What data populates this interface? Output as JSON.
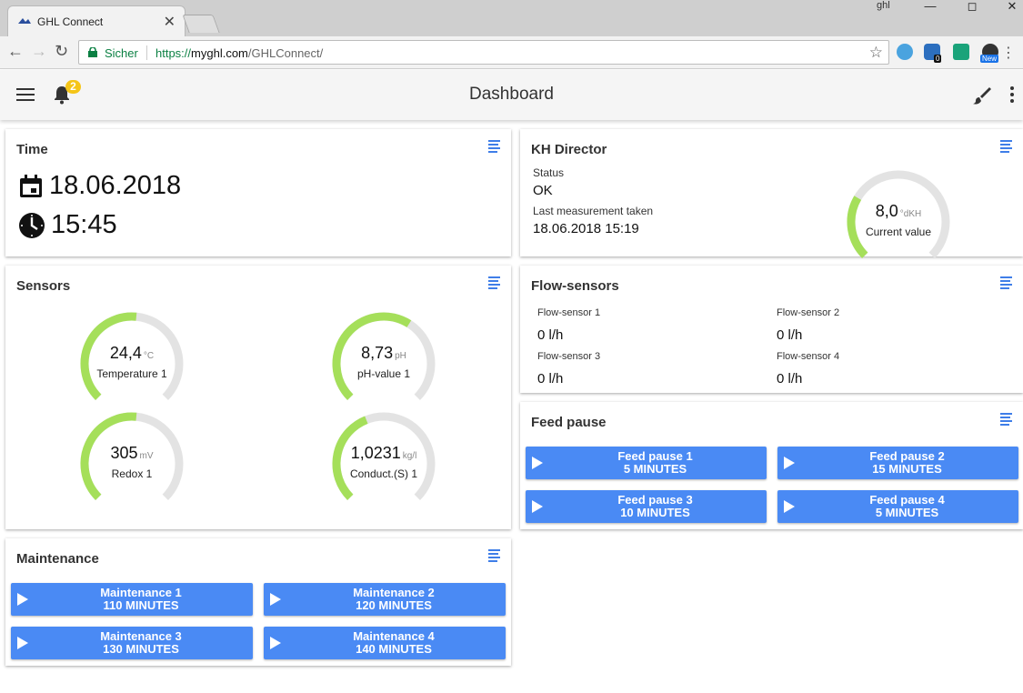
{
  "browser": {
    "tab_title": "GHL Connect",
    "tab_close": "✕",
    "user": "ghl",
    "secure_label": "Sicher",
    "url_scheme": "https://",
    "url_host": "myghl.com",
    "url_path": "/GHLConnect/",
    "ext_badge_count": "0",
    "ext_new_label": "New"
  },
  "app": {
    "title": "Dashboard",
    "notification_count": "2"
  },
  "time_card": {
    "title": "Time",
    "date": "18.06.2018",
    "time": "15:45"
  },
  "kh_card": {
    "title": "KH Director",
    "status_label": "Status",
    "status_value": "OK",
    "last_label": "Last measurement taken",
    "last_value": "18.06.2018 15:19",
    "gauge": {
      "value": "8,0",
      "unit": "°dKH",
      "name": "Current value",
      "fraction": 0.28
    }
  },
  "sensors_card": {
    "title": "Sensors",
    "gauges": [
      {
        "value": "24,4",
        "unit": "°C",
        "name": "Temperature 1",
        "fraction": 0.52
      },
      {
        "value": "8,73",
        "unit": "pH",
        "name": "pH-value 1",
        "fraction": 0.62
      },
      {
        "value": "305",
        "unit": "mV",
        "name": "Redox 1",
        "fraction": 0.52
      },
      {
        "value": "1,0231",
        "unit": "kg/l",
        "name": "Conduct.(S) 1",
        "fraction": 0.42
      }
    ]
  },
  "flow_card": {
    "title": "Flow-sensors",
    "sensors": [
      {
        "label": "Flow-sensor 1",
        "value": "0 l/h"
      },
      {
        "label": "Flow-sensor 2",
        "value": "0 l/h"
      },
      {
        "label": "Flow-sensor 3",
        "value": "0 l/h"
      },
      {
        "label": "Flow-sensor 4",
        "value": "0 l/h"
      }
    ]
  },
  "feed_card": {
    "title": "Feed pause",
    "buttons": [
      {
        "name": "Feed pause 1",
        "duration": "5 MINUTES"
      },
      {
        "name": "Feed pause 2",
        "duration": "15 MINUTES"
      },
      {
        "name": "Feed pause 3",
        "duration": "10 MINUTES"
      },
      {
        "name": "Feed pause 4",
        "duration": "5 MINUTES"
      }
    ]
  },
  "maintenance_card": {
    "title": "Maintenance",
    "buttons": [
      {
        "name": "Maintenance 1",
        "duration": "110 MINUTES"
      },
      {
        "name": "Maintenance 2",
        "duration": "120 MINUTES"
      },
      {
        "name": "Maintenance 3",
        "duration": "130 MINUTES"
      },
      {
        "name": "Maintenance 4",
        "duration": "140 MINUTES"
      }
    ]
  },
  "colors": {
    "gauge_fill": "#a5df5a",
    "gauge_track": "#e3e3e3",
    "button_blue": "#4a8af4",
    "menu_icon_blue": "#3f7ee8",
    "badge_yellow": "#f5c518"
  },
  "icons": {
    "calendar": "calendar-icon",
    "clock": "clock-icon",
    "card_menu": "list-icon",
    "play": "play-icon"
  }
}
